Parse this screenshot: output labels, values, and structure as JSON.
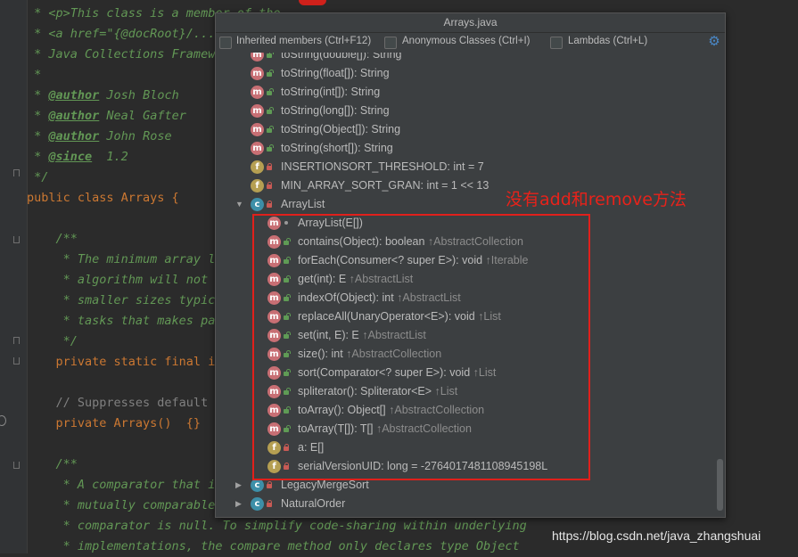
{
  "editor": {
    "lines": [
      {
        "code": " * <p>This class is a member of the",
        "kind": "doc"
      },
      {
        "code": " * <a href=\"{@docRoot}/...",
        "kind": "doc"
      },
      {
        "code": " * Java Collections Framework",
        "kind": "doc"
      },
      {
        "code": " *",
        "kind": "doc"
      },
      {
        "tag": "@author",
        "text": " Josh Bloch",
        "kind": "author"
      },
      {
        "tag": "@author",
        "text": " Neal Gafter",
        "kind": "author"
      },
      {
        "tag": "@author",
        "text": " John Rose",
        "kind": "author"
      },
      {
        "tag": "@since",
        "text": "  1.2",
        "kind": "author"
      },
      {
        "code": " */",
        "kind": "doc"
      },
      {
        "code": "public class Arrays {",
        "kind": "class"
      },
      {
        "code": "",
        "kind": "blank"
      },
      {
        "code": "    /**",
        "kind": "doc"
      },
      {
        "code": "     * The minimum array le",
        "kind": "doc"
      },
      {
        "code": "     * algorithm will not b",
        "kind": "doc"
      },
      {
        "code": "     * smaller sizes typica",
        "kind": "doc"
      },
      {
        "code": "     * tasks that makes par",
        "kind": "doc"
      },
      {
        "code": "     */",
        "kind": "doc"
      },
      {
        "code": "    private static final in",
        "kind": "code"
      },
      {
        "code": "",
        "kind": "blank"
      },
      {
        "code": "    // Suppresses default c",
        "kind": "comment"
      },
      {
        "code": "    private Arrays()  {}",
        "kind": "code"
      },
      {
        "code": "",
        "kind": "blank"
      },
      {
        "code": "    /**",
        "kind": "doc"
      },
      {
        "code": "     * A comparator that im",
        "kind": "doc"
      },
      {
        "code": "     * mutually comparable",
        "kind": "doc"
      },
      {
        "code": "     * comparator is null. To simplify code-sharing within underlying",
        "kind": "doc"
      },
      {
        "code": "     * implementations, the compare method only declares type Object",
        "kind": "doc"
      }
    ]
  },
  "popup": {
    "title": "Arrays.java",
    "filters": [
      {
        "label": "Inherited members (Ctrl+F12)",
        "checked": false
      },
      {
        "label": "Anonymous Classes (Ctrl+I)",
        "checked": false
      },
      {
        "label": "Lambdas (Ctrl+L)",
        "checked": false
      }
    ],
    "settings_icon": "gear-icon",
    "items": [
      {
        "icon": "m",
        "vis": "open",
        "name": "toString(double[]): String",
        "inherited": "",
        "indent": 0
      },
      {
        "icon": "m",
        "vis": "open",
        "name": "toString(float[]): String",
        "inherited": "",
        "indent": 0
      },
      {
        "icon": "m",
        "vis": "open",
        "name": "toString(int[]): String",
        "inherited": "",
        "indent": 0
      },
      {
        "icon": "m",
        "vis": "open",
        "name": "toString(long[]): String",
        "inherited": "",
        "indent": 0
      },
      {
        "icon": "m",
        "vis": "open",
        "name": "toString(Object[]): String",
        "inherited": "",
        "indent": 0
      },
      {
        "icon": "m",
        "vis": "open",
        "name": "toString(short[]): String",
        "inherited": "",
        "indent": 0
      },
      {
        "icon": "f",
        "vis": "lock",
        "name": "INSERTIONSORT_THRESHOLD: int = 7",
        "inherited": "",
        "indent": 0
      },
      {
        "icon": "f",
        "vis": "lock",
        "name": "MIN_ARRAY_SORT_GRAN: int = 1 << 13",
        "inherited": "",
        "indent": 0
      },
      {
        "icon": "c",
        "vis": "lock",
        "name": "ArrayList",
        "inherited": "",
        "indent": 0,
        "expander": "expanded"
      },
      {
        "icon": "m",
        "vis": "dot",
        "name": "ArrayList(E[])",
        "inherited": "",
        "indent": 1
      },
      {
        "icon": "m",
        "vis": "open",
        "name": "contains(Object): boolean",
        "inherited": "↑AbstractCollection",
        "indent": 1
      },
      {
        "icon": "m",
        "vis": "open",
        "name": "forEach(Consumer<? super E>): void",
        "inherited": "↑Iterable",
        "indent": 1
      },
      {
        "icon": "m",
        "vis": "open",
        "name": "get(int): E",
        "inherited": "↑AbstractList",
        "indent": 1
      },
      {
        "icon": "m",
        "vis": "open",
        "name": "indexOf(Object): int",
        "inherited": "↑AbstractList",
        "indent": 1
      },
      {
        "icon": "m",
        "vis": "open",
        "name": "replaceAll(UnaryOperator<E>): void",
        "inherited": "↑List",
        "indent": 1
      },
      {
        "icon": "m",
        "vis": "open",
        "name": "set(int, E): E",
        "inherited": "↑AbstractList",
        "indent": 1
      },
      {
        "icon": "m",
        "vis": "open",
        "name": "size(): int",
        "inherited": "↑AbstractCollection",
        "indent": 1
      },
      {
        "icon": "m",
        "vis": "open",
        "name": "sort(Comparator<? super E>): void",
        "inherited": "↑List",
        "indent": 1
      },
      {
        "icon": "m",
        "vis": "open",
        "name": "spliterator(): Spliterator<E>",
        "inherited": "↑List",
        "indent": 1
      },
      {
        "icon": "m",
        "vis": "open",
        "name": "toArray(): Object[]",
        "inherited": "↑AbstractCollection",
        "indent": 1
      },
      {
        "icon": "m",
        "vis": "open",
        "name": "toArray(T[]): T[]",
        "inherited": "↑AbstractCollection",
        "indent": 1
      },
      {
        "icon": "f",
        "vis": "lock",
        "name": "a: E[]",
        "inherited": "",
        "indent": 1
      },
      {
        "icon": "f",
        "vis": "lock",
        "name": "serialVersionUID: long = -2764017481108945198L",
        "inherited": "",
        "indent": 1
      },
      {
        "icon": "c",
        "vis": "lock",
        "name": "LegacyMergeSort",
        "inherited": "",
        "indent": 0,
        "expander": "collapsed"
      },
      {
        "icon": "c",
        "vis": "lock",
        "name": "NaturalOrder",
        "inherited": "",
        "indent": 0,
        "expander": "collapsed"
      }
    ]
  },
  "annotation": "没有add和remove方法",
  "watermark": "https://blog.csdn.net/java_zhangshuai",
  "colors": {
    "annotation": "#e8221a",
    "method_icon": "#c86f74",
    "field_icon": "#b59f52",
    "class_icon": "#3d8fa8"
  }
}
